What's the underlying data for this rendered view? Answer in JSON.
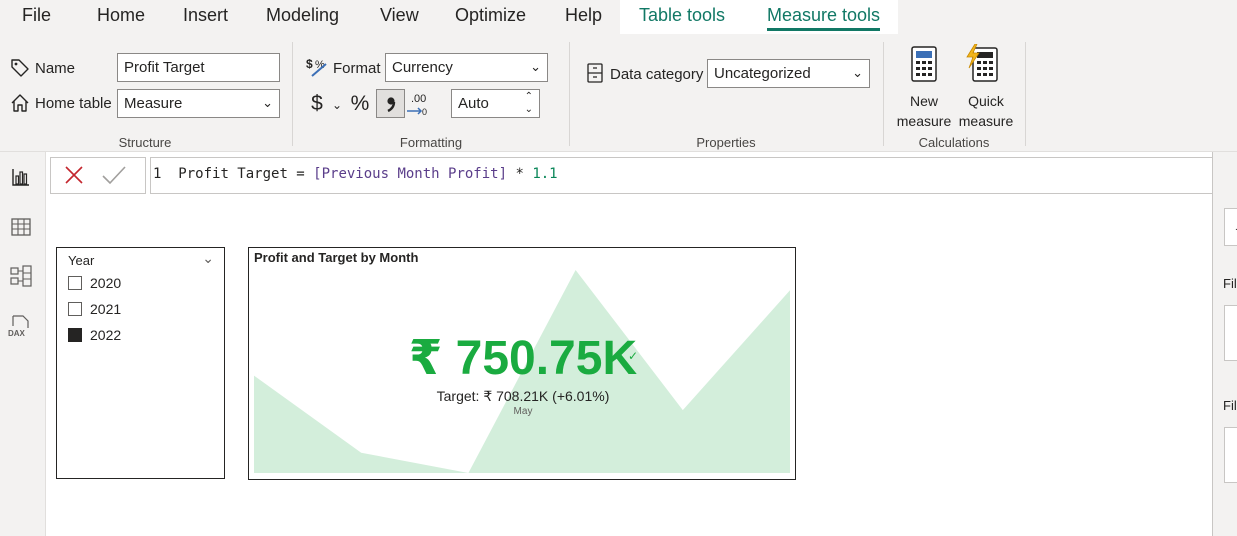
{
  "menu": {
    "file": "File",
    "home": "Home",
    "insert": "Insert",
    "modeling": "Modeling",
    "view": "View",
    "optimize": "Optimize",
    "help": "Help",
    "table_tools": "Table tools",
    "measure_tools": "Measure tools"
  },
  "ribbon": {
    "structure": {
      "name_label": "Name",
      "name_value": "Profit Target",
      "home_table_label": "Home table",
      "home_table_value": "Measure",
      "group_label": "Structure"
    },
    "formatting": {
      "format_label": "Format",
      "format_value": "Currency",
      "currency_symbol": "$",
      "percent_symbol": "%",
      "comma_symbol": "̦",
      "decimals_value": "Auto",
      "group_label": "Formatting"
    },
    "properties": {
      "data_category_label": "Data category",
      "data_category_value": "Uncategorized",
      "group_label": "Properties"
    },
    "calculations": {
      "new_measure_line1": "New",
      "new_measure_line2": "measure",
      "quick_measure_line1": "Quick",
      "quick_measure_line2": "measure",
      "group_label": "Calculations"
    }
  },
  "formula": {
    "line_number": "1",
    "text_start": "Profit Target = ",
    "ref": "[Previous Month Profit]",
    "operator": " * ",
    "number": "1.1"
  },
  "slicer": {
    "title": "Year",
    "items": [
      {
        "label": "2020",
        "checked": false
      },
      {
        "label": "2021",
        "checked": false
      },
      {
        "label": "2022",
        "checked": true
      }
    ]
  },
  "kpi": {
    "title": "Profit and Target by Month",
    "value": "₹ 750.75K",
    "target": "Target: ₹ 708.21K (+6.01%)",
    "period": "May",
    "status_color": "#1aab40",
    "trend_fill": "#d3eedb",
    "trend": [
      0.48,
      0.1,
      0.0,
      1.0,
      0.31,
      0.9
    ]
  },
  "right_pane": {
    "filter_label_1": "Fil",
    "filter_label_2": "Fil",
    "top_box_text": ".."
  }
}
